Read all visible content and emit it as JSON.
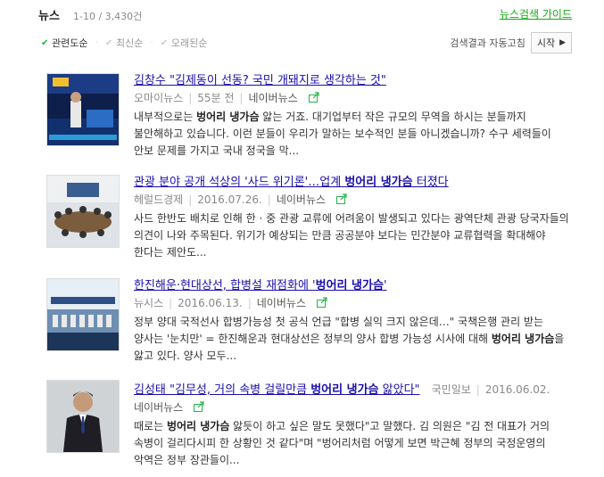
{
  "header": {
    "title": "뉴스",
    "count": "1-10 / 3,430건",
    "guide_link": "뉴스검색 가이드"
  },
  "sort": {
    "options": [
      {
        "label": "관련도순",
        "active": true
      },
      {
        "label": "최신순",
        "active": false
      },
      {
        "label": "오래된순",
        "active": false
      }
    ],
    "auto_label": "검색결과 자동고침",
    "start_label": "시작"
  },
  "keyword": "벙어리 냉가슴",
  "results": [
    {
      "thumb_icon": "conference-stage-photo",
      "title": [
        "김창수 \"김제동이 선동? 국민 개돼지로 생각하는 것\""
      ],
      "source": "오마이뉴스",
      "time": "55분 전",
      "naver": "네이버뉴스",
      "desc": [
        "내부적으로는 ",
        "벙어리 냉가슴",
        " 앓는 거죠. 대기업부터 작은 규모의 무역을 하시는 분들까지 불안해하고 있습니다. 이런 분들이 우리가 말하는 보수적인 분들 아니겠습니까? 수구 세력들이 안보 문제를 가지고 국내 정국을 막..."
      ]
    },
    {
      "thumb_icon": "meeting-room-photo",
      "title": [
        "관광 분야 공개 석상의 '사드 위기론'…업계 ",
        "벙어리 냉가슴",
        " 터졌다"
      ],
      "source": "헤럴드경제",
      "time": "2016.07.26.",
      "naver": "네이버뉴스",
      "desc": [
        "사드 한반도 배치로 인해 한 · 중 관광 교류에 어려움이 발생되고 있다는 광역단체 관광 당국자들의 의견이 나와 주목된다. 위기가 예상되는 만큼 공공분야 보다는 민간분야 교류협력을 확대해야 한다는 제안도..."
      ]
    },
    {
      "thumb_icon": "ship-fleet-photo",
      "title": [
        "한진해운·현대상선, 합병설 재점화에 '",
        "벙어리 냉가슴",
        "'"
      ],
      "source": "뉴시스",
      "time": "2016.06.13.",
      "naver": "네이버뉴스",
      "desc": [
        "정부 양대 국적선사 합병가능성 첫 공식 언급 \"합병 실익 크지 않은데…\" 국책은행 관리 받는 양사는 '눈치만' = 한진해운과 현대상선은 정부의 양사 합병 가능성 시사에 대해 ",
        "벙어리 냉가슴",
        "을 앓고 있다. 양사 모두..."
      ]
    },
    {
      "thumb_icon": "politician-portrait-photo",
      "title": [
        "김성태 \"김무성, 거의 속병 걸릴만큼 ",
        "벙어리 냉가슴",
        " 앓았다\""
      ],
      "source": "국민일보",
      "time": "2016.06.02.",
      "naver": "네이버뉴스",
      "desc": [
        "때로는 ",
        "벙어리 냉가슴",
        " 앓듯이 하고 싶은 말도 못했다\"고 말했다. 김 의원은 \"김 전 대표가 거의 속병이 걸리다시피 한 상황인 것 같다\"며 \"벙어리처럼 어떻게 보면 박근혜 정부의 국정운영의 악역은 정부 장관들이..."
      ]
    }
  ],
  "colors": {
    "link": "#1a0dab",
    "green": "#14a914",
    "check": "#19b44a"
  }
}
